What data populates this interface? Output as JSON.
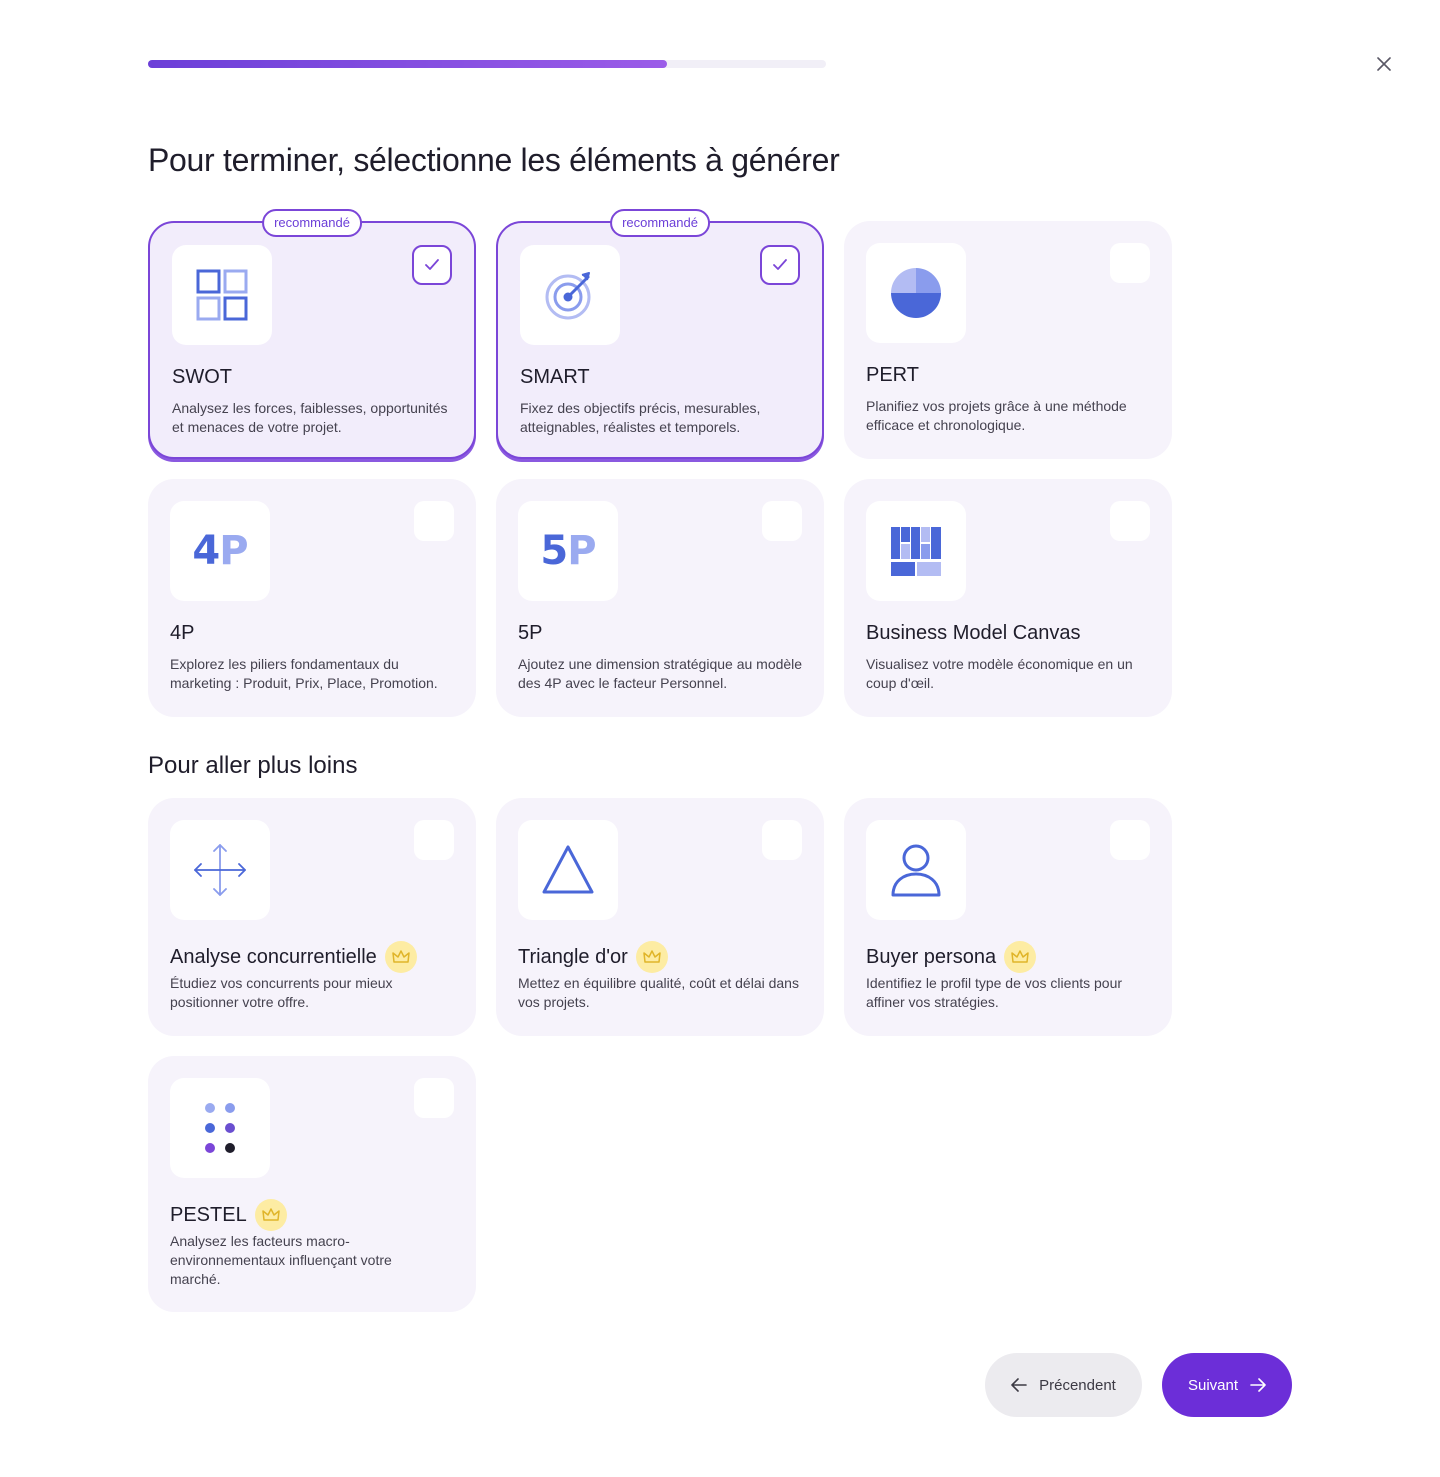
{
  "progress": {
    "fraction": 0.765
  },
  "header": {
    "title": "Pour terminer, sélectionne les éléments à générer"
  },
  "sections": {
    "more_title": "Pour aller plus loins"
  },
  "cards": [
    {
      "id": "swot",
      "title": "SWOT",
      "desc": "Analysez les forces, faiblesses, opportunités et menaces de votre projet.",
      "badge": "recommandé",
      "checked": true,
      "premium": false,
      "icon": "grid-icon"
    },
    {
      "id": "smart",
      "title": "SMART",
      "desc": "Fixez des objectifs précis, mesurables, atteignables, réalistes et temporels.",
      "badge": "recommandé",
      "checked": true,
      "premium": false,
      "icon": "target-icon"
    },
    {
      "id": "pert",
      "title": "PERT",
      "desc": "Planifiez vos projets grâce à une méthode efficace et chronologique.",
      "checked": false,
      "premium": false,
      "icon": "pie-chart-icon"
    },
    {
      "id": "4p",
      "title": "4P",
      "desc": "Explorez les piliers fondamentaux du marketing : Produit, Prix, Place, Promotion.",
      "checked": false,
      "premium": false,
      "icon": "4p-icon",
      "icon_text": [
        "4",
        "P"
      ]
    },
    {
      "id": "5p",
      "title": "5P",
      "desc": "Ajoutez une dimension stratégique au modèle des 4P avec le facteur Personnel.",
      "checked": false,
      "premium": false,
      "icon": "5p-icon",
      "icon_text": [
        "5",
        "P"
      ]
    },
    {
      "id": "bmc",
      "title": "Business Model Canvas",
      "desc": "Visualisez votre modèle économique en un coup d'œil.",
      "checked": false,
      "premium": false,
      "icon": "canvas-icon"
    },
    {
      "id": "concurrence",
      "title": "Analyse concurrentielle",
      "desc": "Étudiez vos concurrents pour mieux positionner votre offre.",
      "checked": false,
      "premium": true,
      "icon": "move-arrows-icon"
    },
    {
      "id": "triangle",
      "title": "Triangle d'or",
      "desc": "Mettez en équilibre qualité, coût et délai dans vos projets.",
      "checked": false,
      "premium": true,
      "icon": "triangle-icon"
    },
    {
      "id": "persona",
      "title": "Buyer persona",
      "desc": "Identifiez le profil type de vos clients pour affiner vos stratégies.",
      "checked": false,
      "premium": true,
      "icon": "user-icon"
    },
    {
      "id": "pestel",
      "title": "PESTEL",
      "desc": "Analysez les facteurs macro-environnementaux influençant votre marché.",
      "checked": false,
      "premium": true,
      "icon": "dots-grid-icon"
    }
  ],
  "footer": {
    "prev_label": "Précendent",
    "next_label": "Suivant"
  },
  "colors": {
    "accent": "#6c2ed8",
    "border_selected": "#7b46d8",
    "icon_blue": "#4a67d8",
    "icon_light": "#9aaaf0",
    "crown_bg": "#fdeca3",
    "crown": "#e0b52a"
  }
}
